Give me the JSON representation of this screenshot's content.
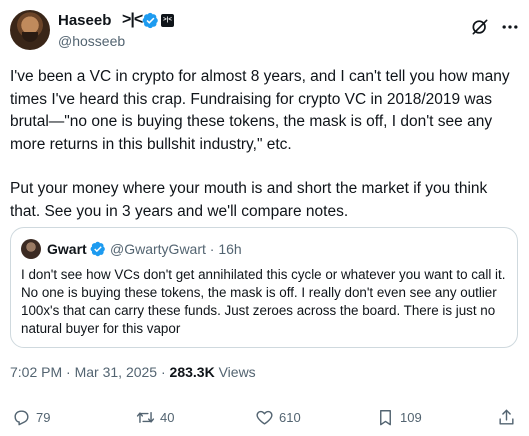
{
  "author": {
    "display_name": "Haseeb",
    "name_suffix": ">|<",
    "handle": "@hosseeb"
  },
  "tweet": {
    "paragraphs": [
      "I've been a VC in crypto for almost 8 years, and I can't tell you how many times I've heard this crap. Fundraising for crypto VC in 2018/2019 was brutal—\"no one is buying these tokens, the mask is off, I don't see any more returns in this bullshit industry,\" etc.",
      "Put your money where your mouth is and short the market if you think that. See you in 3 years and we'll compare notes."
    ]
  },
  "quote": {
    "name": "Gwart",
    "handle": "@GwartyGwart",
    "separator": "·",
    "time": "16h",
    "text": "I don't see how VCs don't get annihilated this cycle or whatever you want to call it. No one is buying these tokens, the mask is off. I really don't even see any outlier 100x's that can carry these funds. Just zeroes across the board. There is just no natural buyer for this vapor"
  },
  "meta": {
    "time": "7:02 PM",
    "separator": "·",
    "date": "Mar 31, 2025",
    "views_count": "283.3K",
    "views_label": "Views"
  },
  "actions": {
    "replies": "79",
    "reposts": "40",
    "likes": "610",
    "bookmarks": "109"
  },
  "icons": {
    "verified": "verified-badge-icon",
    "grok": "grok-icon",
    "more": "more-icon",
    "reply": "reply-icon",
    "repost": "repost-icon",
    "like": "heart-icon",
    "bookmark": "bookmark-icon",
    "share": "share-icon"
  },
  "colors": {
    "verified_blue": "#1d9bf0",
    "secondary_text": "#536471",
    "primary_text": "#0f1419",
    "border": "#cfd9de"
  }
}
